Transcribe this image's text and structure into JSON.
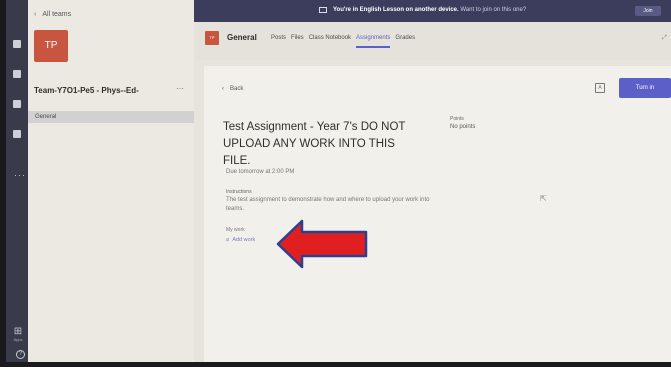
{
  "app": {
    "accent_color": "#5b5fc7",
    "team_color": "#c8553f"
  },
  "rail": {
    "apps_label": "Apps",
    "apps_icon": "apps-grid-icon",
    "help_icon": "help-icon"
  },
  "team_panel": {
    "back_label": "All teams",
    "avatar_initials": "TP",
    "team_name": "Team-Y7O1-Pe5 - Phys--Ed-",
    "more_glyph": "···",
    "channels": [
      "General"
    ]
  },
  "banner": {
    "bold_text": "You're in English Lesson on another device.",
    "rest_text": "Want to join on this one?",
    "join_label": "Join"
  },
  "channel_header": {
    "avatar_initials": "TP",
    "name": "General",
    "tabs": [
      "Posts",
      "Files",
      "Class Notebook",
      "Assignments",
      "Grades"
    ],
    "active_tab": "Assignments"
  },
  "assignment": {
    "back_label": "Back",
    "turn_in_label": "Turn in",
    "title": "Test Assignment - Year 7's DO NOT UPLOAD ANY WORK INTO THIS FILE.",
    "due": "Due tomorrow at 2:00 PM",
    "points_label": "Points",
    "points_value": "No points",
    "instructions_label": "Instructions",
    "instructions_text": "The test assignment to demonstrate how and where to upload your work into teams.",
    "my_work_label": "My work",
    "add_work_label": "Add work"
  },
  "annotation": {
    "arrow_color": "#e02020",
    "arrow_outline": "#2e3f8f"
  }
}
